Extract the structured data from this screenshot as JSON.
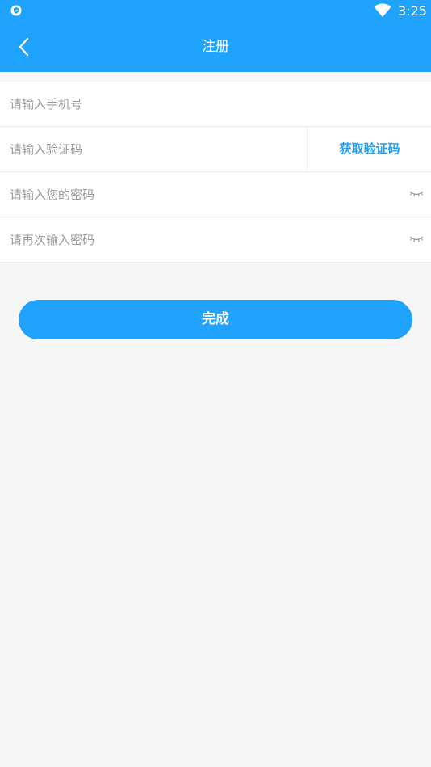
{
  "status_bar": {
    "time": "3:25",
    "icons": [
      "shield-icon",
      "wifi-icon"
    ]
  },
  "header": {
    "title": "注册",
    "back_icon": "chevron-left-icon",
    "background": "#1fa3fd"
  },
  "form": {
    "phone": {
      "placeholder": "请输入手机号",
      "value": ""
    },
    "code": {
      "placeholder": "请输入验证码",
      "value": "",
      "button_label": "获取验证码"
    },
    "password": {
      "placeholder": "请输入您的密码",
      "value": "",
      "toggle_icon": "eye-closed-icon"
    },
    "password_confirm": {
      "placeholder": "请再次输入密码",
      "value": "",
      "toggle_icon": "eye-closed-icon"
    }
  },
  "submit": {
    "label": "完成"
  },
  "colors": {
    "accent": "#1fa3fd",
    "page_bg": "#f6f6f6",
    "placeholder": "#9a9a9a"
  }
}
